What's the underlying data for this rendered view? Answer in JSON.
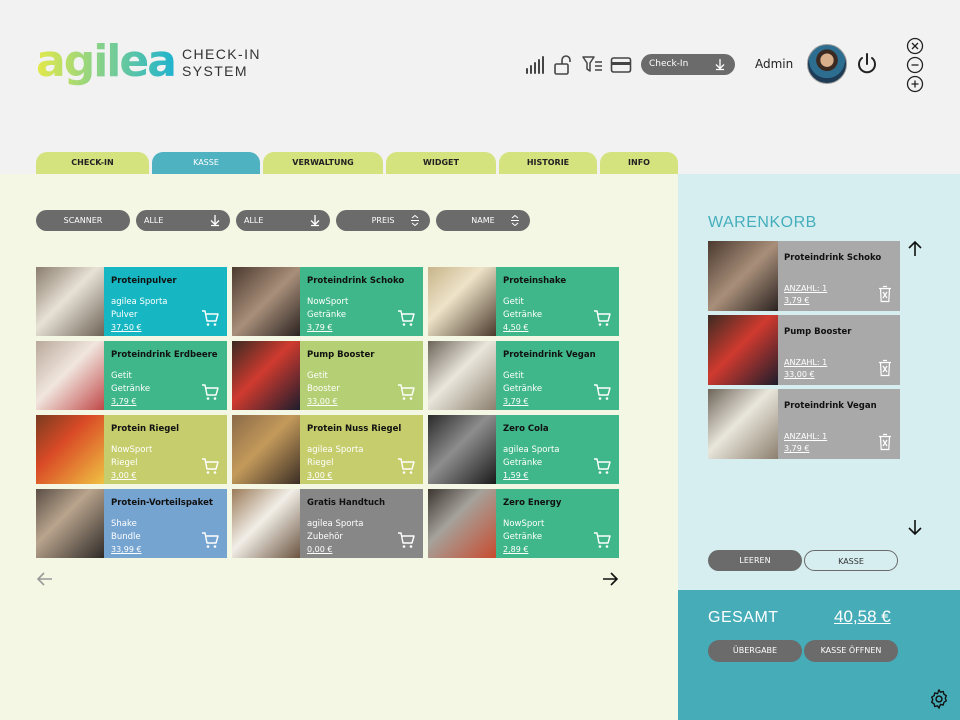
{
  "header": {
    "logo_text": "agilea",
    "logo_sub_1": "CHECK-IN",
    "logo_sub_2": "SYSTEM",
    "icons": [
      "signal-icon",
      "lock-icon",
      "filter-list-icon",
      "card-icon"
    ],
    "mode_select_value": "Check-In",
    "user_name": "Admin"
  },
  "tabs": [
    {
      "label": "CHECK-IN"
    },
    {
      "label": "KASSE"
    },
    {
      "label": "VERWALTUNG"
    },
    {
      "label": "WIDGET"
    },
    {
      "label": "HISTORIE"
    },
    {
      "label": "INFO"
    }
  ],
  "filters": {
    "scanner": "SCANNER",
    "category": "ALLE",
    "brand": "ALLE",
    "price": "PREIS",
    "name": "NAME"
  },
  "products": [
    {
      "name": "Proteinpulver",
      "brand": "agilea Sporta",
      "category": "Pulver",
      "price": "37,50 €",
      "color": "#16b7c2"
    },
    {
      "name": "Proteindrink Schoko",
      "brand": "NowSport",
      "category": "Getränke",
      "price": "3,79 €",
      "color": "#3fb78a"
    },
    {
      "name": "Proteinshake",
      "brand": "Getit",
      "category": "Getränke",
      "price": "4,50 €",
      "color": "#3fb78a"
    },
    {
      "name": "Proteindrink Erdbeere",
      "brand": "Getit",
      "category": "Getränke",
      "price": "3,79 €",
      "color": "#3fb78a"
    },
    {
      "name": "Pump Booster",
      "brand": "Getit",
      "category": "Booster",
      "price": "33,00 €",
      "color": "#b5cf74"
    },
    {
      "name": "Proteindrink Vegan",
      "brand": "Getit",
      "category": "Getränke",
      "price": "3,79 €",
      "color": "#3fb78a"
    },
    {
      "name": "Protein Riegel",
      "brand": "NowSport",
      "category": "Riegel",
      "price": "3,00 €",
      "color": "#c6cd6d"
    },
    {
      "name": "Protein Nuss Riegel",
      "brand": "agilea Sporta",
      "category": "Riegel",
      "price": "3,00 €",
      "color": "#c6cd6d"
    },
    {
      "name": "Zero Cola",
      "brand": "agilea Sporta",
      "category": "Getränke",
      "price": "1,59 €",
      "color": "#3fb78a"
    },
    {
      "name": "Protein-Vorteilspaket",
      "brand": "Shake",
      "category": "Bundle",
      "price": "33,99 €",
      "color": "#76a4d0"
    },
    {
      "name": "Gratis Handtuch",
      "brand": "agilea Sporta",
      "category": "Zubehör",
      "price": "0,00 €",
      "color": "#878787"
    },
    {
      "name": "Zero Energy",
      "brand": "NowSport",
      "category": "Getränke",
      "price": "2,89 €",
      "color": "#3fb78a"
    }
  ],
  "cart": {
    "title": "WARENKORB",
    "items": [
      {
        "name": "Proteindrink Schoko",
        "qty": "ANZAHL: 1",
        "price": "3,79 €"
      },
      {
        "name": "Pump Booster",
        "qty": "ANZAHL: 1",
        "price": "33,00 €"
      },
      {
        "name": "Proteindrink Vegan",
        "qty": "ANZAHL: 1",
        "price": "3,79 €"
      }
    ],
    "clear_label": "LEEREN",
    "checkout_label": "KASSE"
  },
  "total": {
    "label": "GESAMT",
    "value": "40,58 €",
    "handover_label": "ÜBERGABE",
    "open_register_label": "KASSE ÖFFNEN"
  }
}
